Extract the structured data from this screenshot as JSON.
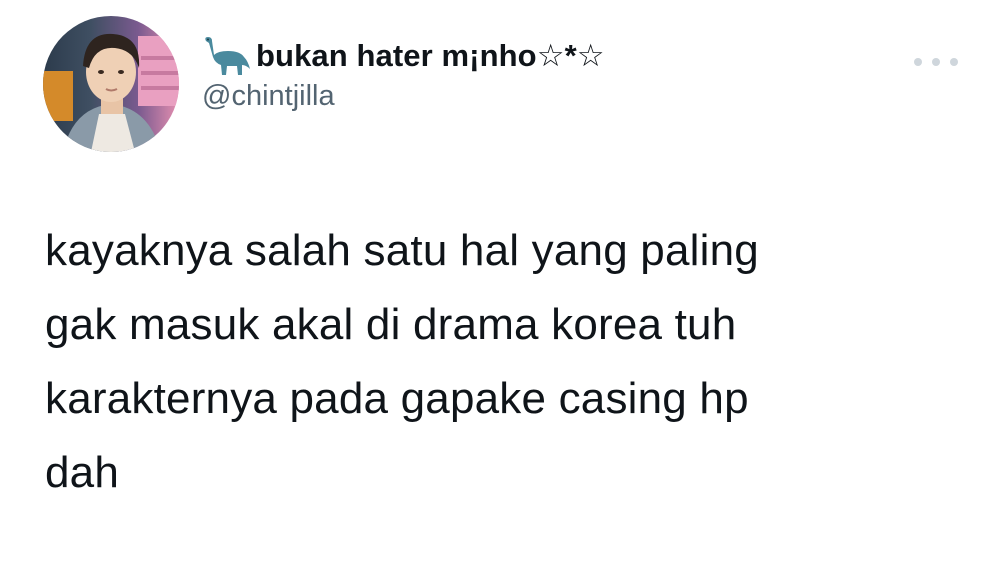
{
  "tweet": {
    "author": {
      "display_name": "bukan hater m¡nho☆*☆",
      "handle": "@chintjilla",
      "name_prefix_icon": "sauropod-dinosaur-icon",
      "avatar_icon": "profile-photo-avatar"
    },
    "menu_icon": "more-options-icon",
    "text_lines": [
      "kayaknya salah satu hal yang paling",
      "gak masuk akal di drama korea tuh",
      "karakternya pada gapake casing hp",
      "dah"
    ],
    "colors": {
      "text": "#0f1419",
      "secondary_text": "#536471",
      "dino": "#4a8a9e",
      "more_dots": "#cfd6dc"
    }
  }
}
